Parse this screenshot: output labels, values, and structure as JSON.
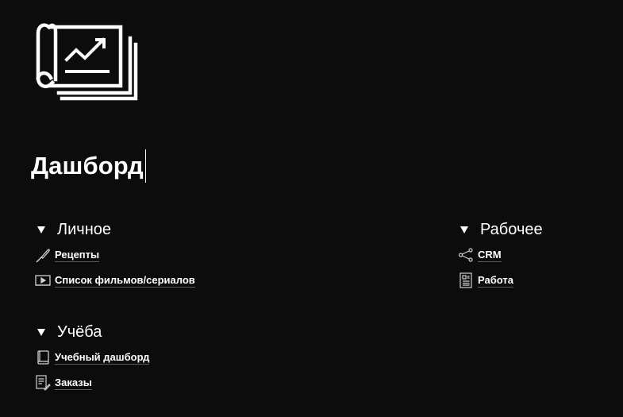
{
  "page": {
    "icon": "chart-scroll-icon",
    "title": "Дашборд"
  },
  "sections": {
    "personal": {
      "title": "Личное",
      "items": [
        {
          "label": "Рецепты",
          "icon": "knife-icon"
        },
        {
          "label": "Список фильмов/сериалов",
          "icon": "video-player-icon"
        }
      ]
    },
    "study": {
      "title": "Учёба",
      "items": [
        {
          "label": "Учебный дашборд",
          "icon": "book-icon"
        },
        {
          "label": "Заказы",
          "icon": "document-pen-icon"
        }
      ]
    },
    "work": {
      "title": "Рабочее",
      "items": [
        {
          "label": "CRM",
          "icon": "share-nodes-icon"
        },
        {
          "label": "Работа",
          "icon": "profile-document-icon"
        }
      ]
    }
  }
}
